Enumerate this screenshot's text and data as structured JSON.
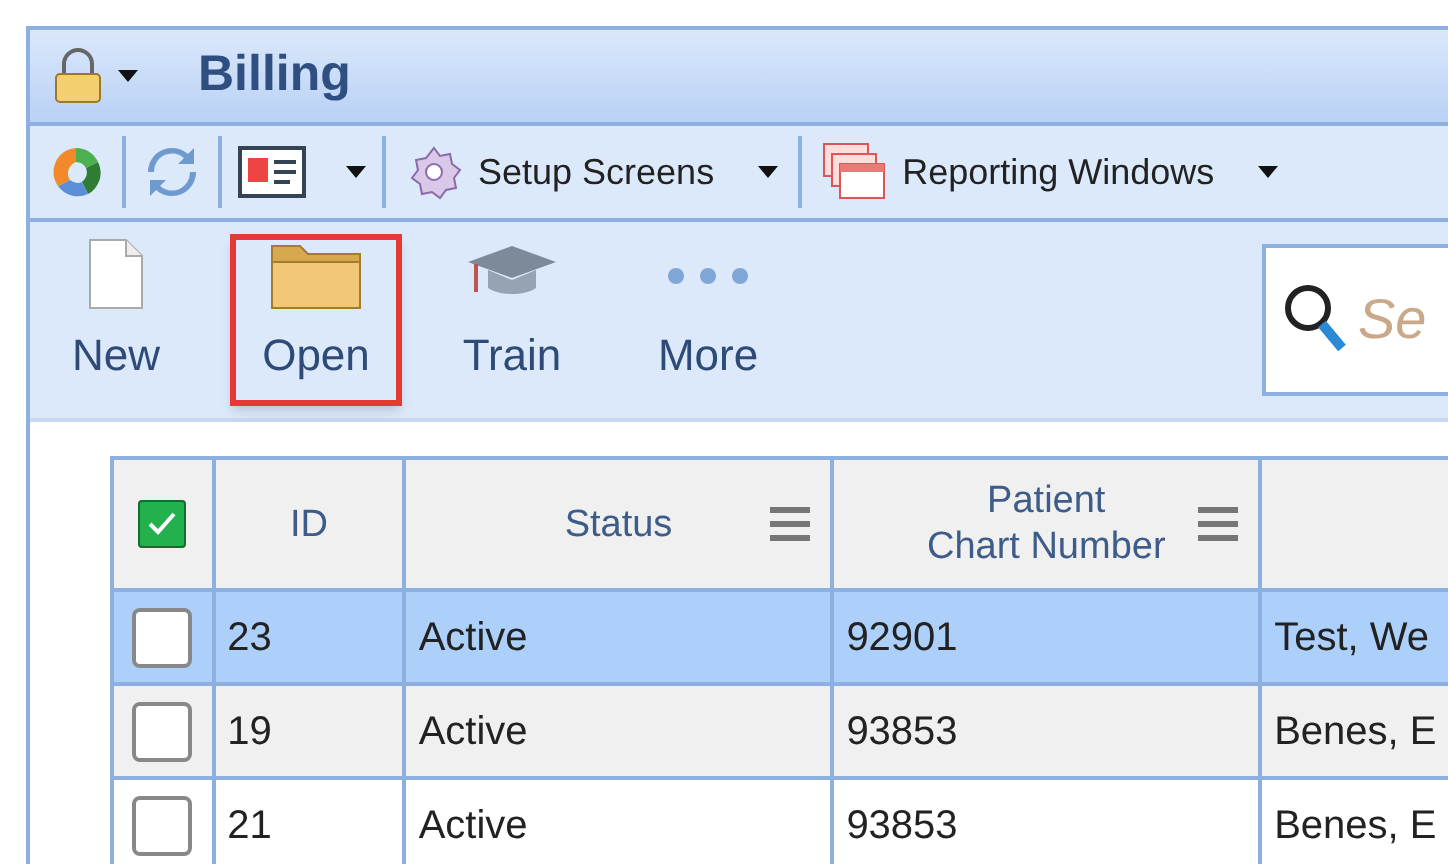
{
  "window": {
    "title": "Billing"
  },
  "toolbar": [
    {
      "label": "Setup Screens"
    },
    {
      "label": "Reporting Windows"
    }
  ],
  "ribbon": [
    {
      "kind": "new",
      "label": "New",
      "highlighted": false
    },
    {
      "kind": "open",
      "label": "Open",
      "highlighted": true
    },
    {
      "kind": "train",
      "label": "Train",
      "highlighted": false
    },
    {
      "kind": "more",
      "label": "More",
      "highlighted": false
    }
  ],
  "search": {
    "placeholder": "Se"
  },
  "table": {
    "all_checked": true,
    "columns": [
      {
        "label": "ID",
        "menu": false
      },
      {
        "label": "Status",
        "menu": true
      },
      {
        "label": "Patient\nChart Number",
        "menu": true
      },
      {
        "menu": false
      }
    ],
    "rows": [
      {
        "selected": true,
        "checked": false,
        "cells": [
          "23",
          "Active",
          "92901",
          "Test, We"
        ]
      },
      {
        "selected": false,
        "checked": false,
        "cells": [
          "19",
          "Active",
          "93853",
          "Benes, E"
        ]
      },
      {
        "selected": false,
        "checked": false,
        "cells": [
          "21",
          "Active",
          "93853",
          "Benes, E"
        ]
      }
    ]
  }
}
